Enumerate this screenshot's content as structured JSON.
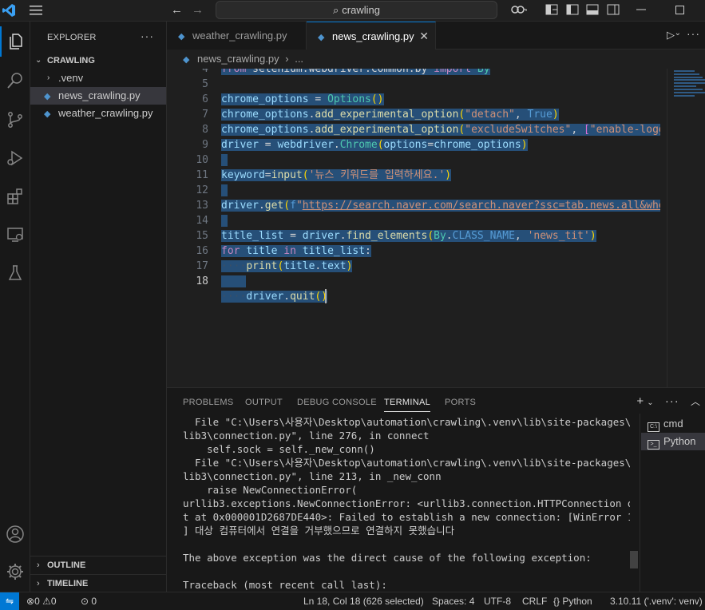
{
  "titlebar": {
    "search_text": "crawling",
    "icons": [
      "vscode-logo-icon",
      "menu-icon",
      "back-arrow-icon",
      "forward-arrow-icon",
      "copilot-icon",
      "layout-icon",
      "toggle-sidebar-icon",
      "toggle-panel-icon",
      "toggle-secondary-sidebar-icon",
      "minimize-icon",
      "maximize-icon"
    ]
  },
  "activity_bar": {
    "items": [
      "explorer-icon",
      "search-icon",
      "source-control-icon",
      "run-debug-icon",
      "extensions-icon",
      "remote-explorer-icon",
      "testing-icon",
      "accounts-icon",
      "manage-gear-icon"
    ]
  },
  "sidebar": {
    "title": "EXPLORER",
    "more": "···",
    "folder": "CRAWLING",
    "items": [
      {
        "label": ".venv"
      },
      {
        "label": "news_crawling.py"
      },
      {
        "label": "weather_crawling.py"
      }
    ],
    "outline": "OUTLINE",
    "timeline": "TIMELINE"
  },
  "tabs": [
    {
      "label": "weather_crawling.py",
      "active": false
    },
    {
      "label": "news_crawling.py",
      "active": true
    }
  ],
  "breadcrumb": {
    "file": "news_crawling.py",
    "more": "..."
  },
  "editor": {
    "line_numbers": [
      "4",
      "5",
      "6",
      "7",
      "8",
      "9",
      "10",
      "11",
      "12",
      "13",
      "14",
      "15",
      "16",
      "17",
      "18"
    ],
    "current_line": "18"
  },
  "panel": {
    "tabs": [
      "PROBLEMS",
      "OUTPUT",
      "DEBUG CONSOLE",
      "TERMINAL",
      "PORTS"
    ],
    "active_tab": "TERMINAL",
    "terminal_lines": [
      "  File \"C:\\Users\\사용자\\Desktop\\automation\\crawling\\.venv\\lib\\site-packages\\url",
      "lib3\\connection.py\", line 276, in connect",
      "    self.sock = self._new_conn()",
      "  File \"C:\\Users\\사용자\\Desktop\\automation\\crawling\\.venv\\lib\\site-packages\\url",
      "lib3\\connection.py\", line 213, in _new_conn",
      "    raise NewConnectionError(",
      "urllib3.exceptions.NewConnectionError: <urllib3.connection.HTTPConnection objec",
      "t at 0x000001D2687DE440>: Failed to establish a new connection: [WinError 10061",
      "] 대상 컴퓨터에서 연결을 거부했으므로 연결하지 못했습니다",
      "",
      "The above exception was the direct cause of the following exception:",
      "",
      "Traceback (most recent call last):"
    ],
    "terminals": [
      {
        "label": "cmd",
        "icon": "C:\\"
      },
      {
        "label": "Python",
        "icon": ">_"
      }
    ]
  },
  "statusbar": {
    "errors": "0",
    "warnings": "0",
    "ports": "0",
    "position": "Ln 18, Col 18 (626 selected)",
    "spaces": "Spaces: 4",
    "encoding": "UTF-8",
    "eol": "CRLF",
    "language": "Python",
    "interpreter": "3.10.11 ('.venv': venv)"
  },
  "colors": {
    "selection": "#264f78",
    "accent": "#0078d4",
    "editor_bg": "#1f1f1f",
    "sidebar_bg": "#181818"
  }
}
